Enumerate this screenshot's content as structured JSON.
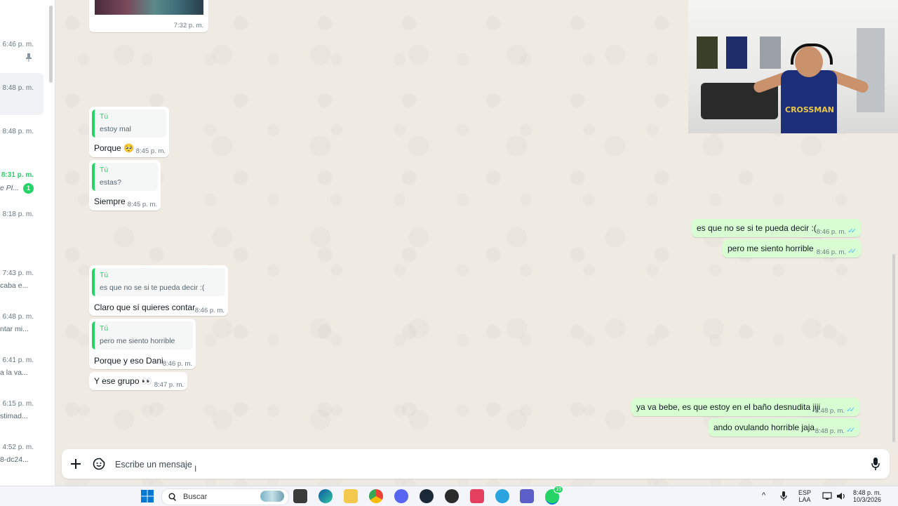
{
  "chat_list": {
    "items": [
      {
        "time": "6:46 p. m.",
        "preview": "",
        "pinned": true
      },
      {
        "time": "8:48 p. m.",
        "preview": ""
      },
      {
        "time": "8:48 p. m.",
        "preview": ""
      },
      {
        "time": "8:31 p. m.",
        "preview": "e Pl...",
        "unread": "1"
      },
      {
        "time": "8:18 p. m.",
        "preview": ""
      },
      {
        "time": "7:43 p. m.",
        "preview": "caba e..."
      },
      {
        "time": "6:48 p. m.",
        "preview": "ntar mi..."
      },
      {
        "time": "6:41 p. m.",
        "preview": "a la va..."
      },
      {
        "time": "6:15 p. m.",
        "preview": "stimad..."
      },
      {
        "time": "4:52 p. m.",
        "preview": "8-dc24..."
      }
    ]
  },
  "conversation": {
    "messages": [
      {
        "dir": "in",
        "time": "7:32 p. m.",
        "media": true
      },
      {
        "dir": "in",
        "quote_author": "Tú",
        "quote_text": "estoy mal",
        "text": "Porque 🥺",
        "time": "8:45 p. m."
      },
      {
        "dir": "in",
        "quote_author": "Tú",
        "quote_text": "estas?",
        "text": "Siempre",
        "time": "8:45 p. m."
      },
      {
        "dir": "out",
        "text": "es que no se si te pueda decir :(",
        "time": "8:46 p. m.",
        "ticks": "✓✓"
      },
      {
        "dir": "out",
        "text": "pero me siento horrible",
        "time": "8:46 p. m.",
        "ticks": "✓✓"
      },
      {
        "dir": "in",
        "quote_author": "Tú",
        "quote_text": "es que no se si te pueda decir :(",
        "text": "Claro que sí quieres contar",
        "time": "8:46 p. m."
      },
      {
        "dir": "in",
        "quote_author": "Tú",
        "quote_text": "pero me siento horrible",
        "text": "Porque y eso Dani",
        "time": "8:46 p. m."
      },
      {
        "dir": "in",
        "text": "Y ese grupo 👀",
        "time": "8:47 p. m."
      },
      {
        "dir": "out",
        "text": "ya va bebe, es que estoy en el baño desnudita jiji",
        "time": "8:48 p. m.",
        "ticks": "✓✓"
      },
      {
        "dir": "out",
        "text": "ando ovulando horrible jaja",
        "time": "8:48 p. m.",
        "ticks": "✓✓"
      }
    ]
  },
  "composer": {
    "plus_icon": "plus-icon",
    "sticker_icon": "sticker-icon",
    "placeholder": "Escribe un mensaje",
    "mic_icon": "microphone-icon"
  },
  "webcam": {
    "shirt_text": "CROSSMAN"
  },
  "taskbar": {
    "search_label": "Buscar",
    "lang_line1": "ESP",
    "lang_line2": "LAA",
    "clock_time": "8:48 p. m.",
    "clock_date": "10/3/2026",
    "whatsapp_badge": "15"
  },
  "colors": {
    "accent": "#25d366",
    "outgoing_bubble": "#d9fdd3",
    "read_ticks": "#53bdeb",
    "chat_background": "#efeae2"
  }
}
